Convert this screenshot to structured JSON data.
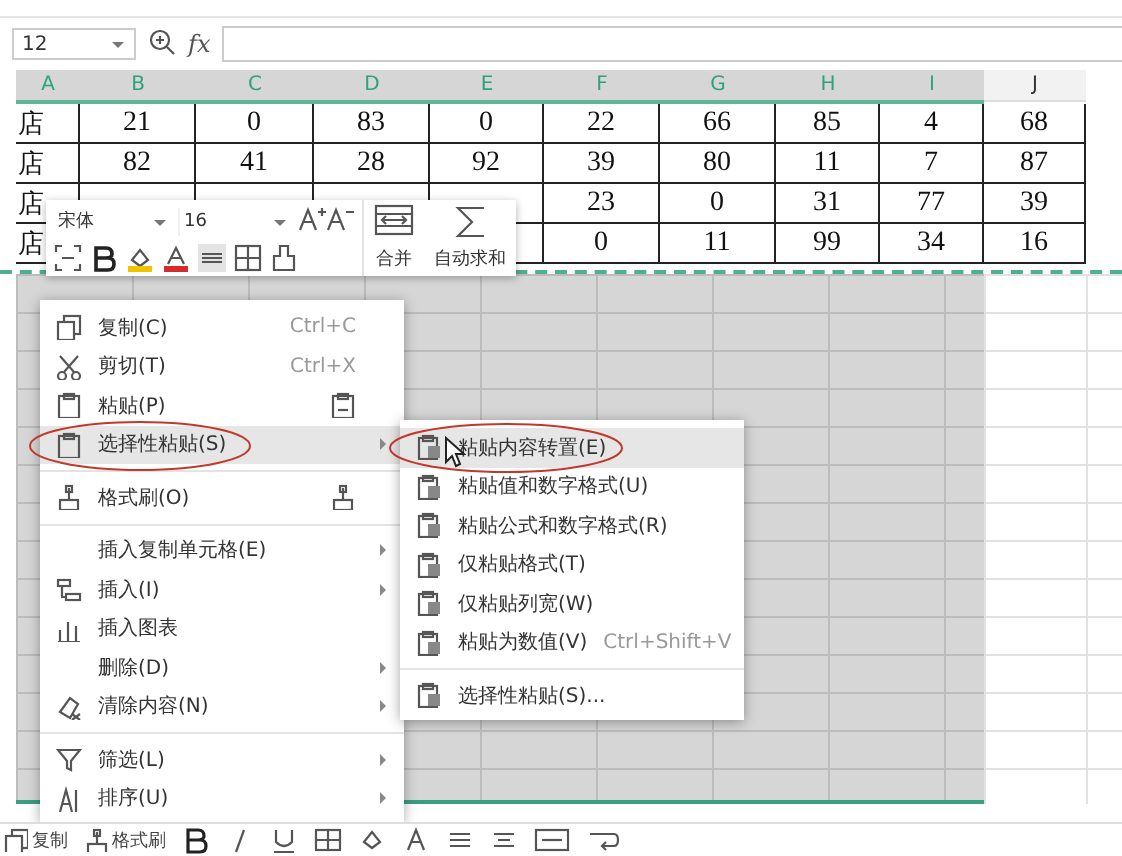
{
  "formula_bar": {
    "name_box": "12",
    "fx": "fx"
  },
  "columns": [
    {
      "label": "A",
      "selected": true
    },
    {
      "label": "B",
      "selected": true
    },
    {
      "label": "C",
      "selected": true
    },
    {
      "label": "D",
      "selected": true
    },
    {
      "label": "E",
      "selected": true
    },
    {
      "label": "F",
      "selected": true
    },
    {
      "label": "G",
      "selected": true
    },
    {
      "label": "H",
      "selected": true
    },
    {
      "label": "I",
      "selected": true
    },
    {
      "label": "J",
      "selected": false
    }
  ],
  "rows": [
    [
      "店",
      "21",
      "0",
      "83",
      "0",
      "22",
      "66",
      "85",
      "4",
      "68"
    ],
    [
      "店",
      "82",
      "41",
      "28",
      "92",
      "39",
      "80",
      "11",
      "7",
      "87"
    ],
    [
      "店",
      null,
      null,
      null,
      null,
      "23",
      "0",
      "31",
      "77",
      "39"
    ],
    [
      "店",
      null,
      null,
      null,
      null,
      "0",
      "11",
      "99",
      "34",
      "16"
    ]
  ],
  "mini_toolbar": {
    "font": "宋体",
    "size": "16",
    "merge": "合并",
    "autosum": "自动求和"
  },
  "context_menu": {
    "items": [
      {
        "kind": "item",
        "label": "复制(C)",
        "shortcut": "Ctrl+C",
        "submenu": false,
        "selected": false,
        "circled": false
      },
      {
        "kind": "item",
        "label": "剪切(T)",
        "shortcut": "Ctrl+X",
        "submenu": false,
        "selected": false,
        "circled": false
      },
      {
        "kind": "item",
        "label": "粘贴(P)",
        "submenu": false,
        "selected": false,
        "circled": false
      },
      {
        "kind": "item",
        "label": "选择性粘贴(S)",
        "submenu": true,
        "selected": true,
        "circled": true
      },
      {
        "kind": "separator"
      },
      {
        "kind": "item",
        "label": "格式刷(O)",
        "submenu": false,
        "selected": false,
        "circled": false
      },
      {
        "kind": "separator"
      },
      {
        "kind": "item",
        "label": "插入复制单元格(E)",
        "submenu": true,
        "selected": false,
        "circled": false
      },
      {
        "kind": "item",
        "label": "插入(I)",
        "submenu": true,
        "selected": false,
        "circled": false
      },
      {
        "kind": "item",
        "label": "插入图表",
        "submenu": false,
        "selected": false,
        "circled": false
      },
      {
        "kind": "item",
        "label": "删除(D)",
        "submenu": true,
        "selected": false,
        "circled": false
      },
      {
        "kind": "item",
        "label": "清除内容(N)",
        "submenu": true,
        "selected": false,
        "circled": false
      },
      {
        "kind": "separator"
      },
      {
        "kind": "item",
        "label": "筛选(L)",
        "submenu": true,
        "selected": false,
        "circled": false
      },
      {
        "kind": "item",
        "label": "排序(U)",
        "submenu": true,
        "selected": false,
        "circled": false
      }
    ]
  },
  "submenu": {
    "items": [
      {
        "kind": "item",
        "label": "粘贴内容转置(E)",
        "submenu": false,
        "selected": true,
        "circled": true
      },
      {
        "kind": "item",
        "label": "粘贴值和数字格式(U)",
        "submenu": false,
        "selected": false,
        "circled": false
      },
      {
        "kind": "item",
        "label": "粘贴公式和数字格式(R)",
        "submenu": false,
        "selected": false,
        "circled": false
      },
      {
        "kind": "item",
        "label": "仅粘贴格式(T)",
        "submenu": false,
        "selected": false,
        "circled": false
      },
      {
        "kind": "item",
        "label": "仅粘贴列宽(W)",
        "submenu": false,
        "selected": false,
        "circled": false
      },
      {
        "kind": "item",
        "label": "粘贴为数值(V)",
        "shortcut": "Ctrl+Shift+V",
        "submenu": false,
        "selected": false,
        "circled": false
      },
      {
        "kind": "separator"
      },
      {
        "kind": "item",
        "label": "选择性粘贴(S)...",
        "submenu": false,
        "selected": false,
        "circled": false
      }
    ]
  },
  "bottom_toolbar": {
    "items": [
      "复制",
      "格式刷"
    ]
  }
}
